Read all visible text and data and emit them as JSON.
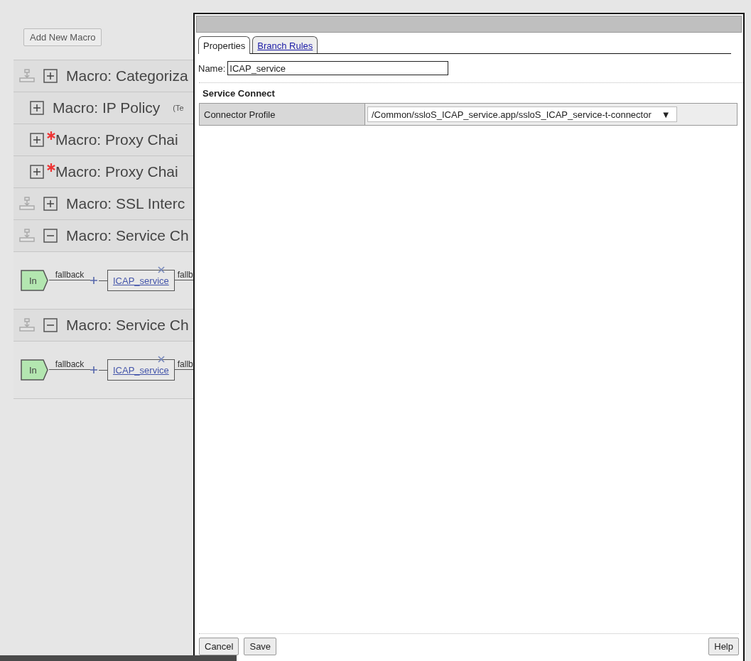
{
  "toolbar": {
    "add_button": "Add New Macro"
  },
  "macros": [
    {
      "kind": "movable",
      "title": "Macro: Categoriza",
      "expanded": false,
      "required": false
    },
    {
      "kind": "nested",
      "title": "Macro: IP Policy",
      "note": "(Te",
      "expanded": false,
      "required": false
    },
    {
      "kind": "nested",
      "title": "Macro: Proxy Chai",
      "expanded": false,
      "required": true
    },
    {
      "kind": "nested",
      "title": "Macro: Proxy Chai",
      "expanded": false,
      "required": true
    },
    {
      "kind": "movable",
      "title": "Macro: SSL Interc",
      "expanded": false,
      "required": false
    },
    {
      "kind": "movable",
      "title": "Macro: Service Ch",
      "expanded": true,
      "required": false,
      "chain": {
        "start": "In",
        "link_label": "fallback",
        "service": "ICAP_service",
        "next_label": "fallb"
      }
    },
    {
      "kind": "movable",
      "title": "Macro: Service Ch",
      "expanded": true,
      "required": false,
      "chain": {
        "start": "In",
        "link_label": "fallback",
        "service": "ICAP_service",
        "next_label": "fallb"
      }
    }
  ],
  "dialog": {
    "tabs": [
      {
        "label": "Properties",
        "selected": true
      },
      {
        "label": "Branch Rules",
        "selected": false
      }
    ],
    "name_label": "Name:",
    "name_value": "ICAP_service",
    "section": "Service Connect",
    "fields": [
      {
        "label": "Connector Profile",
        "value": "/Common/ssloS_ICAP_service.app/ssloS_ICAP_service-t-connector",
        "arrow": "▼"
      }
    ],
    "buttons": [
      "Cancel",
      "Save"
    ],
    "help": "Help"
  }
}
